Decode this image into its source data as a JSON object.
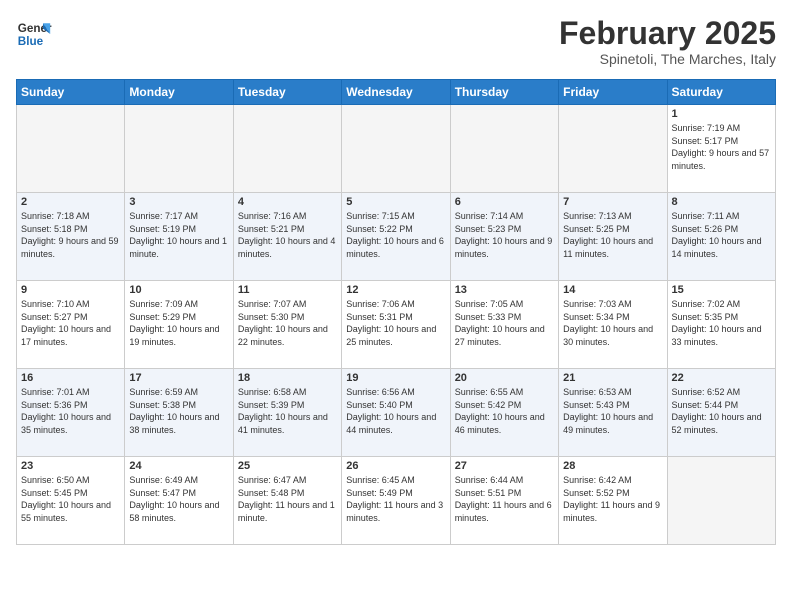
{
  "header": {
    "logo_general": "General",
    "logo_blue": "Blue",
    "month_title": "February 2025",
    "subtitle": "Spinetoli, The Marches, Italy"
  },
  "days_of_week": [
    "Sunday",
    "Monday",
    "Tuesday",
    "Wednesday",
    "Thursday",
    "Friday",
    "Saturday"
  ],
  "weeks": [
    {
      "alt": false,
      "days": [
        {
          "num": "",
          "info": ""
        },
        {
          "num": "",
          "info": ""
        },
        {
          "num": "",
          "info": ""
        },
        {
          "num": "",
          "info": ""
        },
        {
          "num": "",
          "info": ""
        },
        {
          "num": "",
          "info": ""
        },
        {
          "num": "1",
          "info": "Sunrise: 7:19 AM\nSunset: 5:17 PM\nDaylight: 9 hours and 57 minutes."
        }
      ]
    },
    {
      "alt": true,
      "days": [
        {
          "num": "2",
          "info": "Sunrise: 7:18 AM\nSunset: 5:18 PM\nDaylight: 9 hours and 59 minutes."
        },
        {
          "num": "3",
          "info": "Sunrise: 7:17 AM\nSunset: 5:19 PM\nDaylight: 10 hours and 1 minute."
        },
        {
          "num": "4",
          "info": "Sunrise: 7:16 AM\nSunset: 5:21 PM\nDaylight: 10 hours and 4 minutes."
        },
        {
          "num": "5",
          "info": "Sunrise: 7:15 AM\nSunset: 5:22 PM\nDaylight: 10 hours and 6 minutes."
        },
        {
          "num": "6",
          "info": "Sunrise: 7:14 AM\nSunset: 5:23 PM\nDaylight: 10 hours and 9 minutes."
        },
        {
          "num": "7",
          "info": "Sunrise: 7:13 AM\nSunset: 5:25 PM\nDaylight: 10 hours and 11 minutes."
        },
        {
          "num": "8",
          "info": "Sunrise: 7:11 AM\nSunset: 5:26 PM\nDaylight: 10 hours and 14 minutes."
        }
      ]
    },
    {
      "alt": false,
      "days": [
        {
          "num": "9",
          "info": "Sunrise: 7:10 AM\nSunset: 5:27 PM\nDaylight: 10 hours and 17 minutes."
        },
        {
          "num": "10",
          "info": "Sunrise: 7:09 AM\nSunset: 5:29 PM\nDaylight: 10 hours and 19 minutes."
        },
        {
          "num": "11",
          "info": "Sunrise: 7:07 AM\nSunset: 5:30 PM\nDaylight: 10 hours and 22 minutes."
        },
        {
          "num": "12",
          "info": "Sunrise: 7:06 AM\nSunset: 5:31 PM\nDaylight: 10 hours and 25 minutes."
        },
        {
          "num": "13",
          "info": "Sunrise: 7:05 AM\nSunset: 5:33 PM\nDaylight: 10 hours and 27 minutes."
        },
        {
          "num": "14",
          "info": "Sunrise: 7:03 AM\nSunset: 5:34 PM\nDaylight: 10 hours and 30 minutes."
        },
        {
          "num": "15",
          "info": "Sunrise: 7:02 AM\nSunset: 5:35 PM\nDaylight: 10 hours and 33 minutes."
        }
      ]
    },
    {
      "alt": true,
      "days": [
        {
          "num": "16",
          "info": "Sunrise: 7:01 AM\nSunset: 5:36 PM\nDaylight: 10 hours and 35 minutes."
        },
        {
          "num": "17",
          "info": "Sunrise: 6:59 AM\nSunset: 5:38 PM\nDaylight: 10 hours and 38 minutes."
        },
        {
          "num": "18",
          "info": "Sunrise: 6:58 AM\nSunset: 5:39 PM\nDaylight: 10 hours and 41 minutes."
        },
        {
          "num": "19",
          "info": "Sunrise: 6:56 AM\nSunset: 5:40 PM\nDaylight: 10 hours and 44 minutes."
        },
        {
          "num": "20",
          "info": "Sunrise: 6:55 AM\nSunset: 5:42 PM\nDaylight: 10 hours and 46 minutes."
        },
        {
          "num": "21",
          "info": "Sunrise: 6:53 AM\nSunset: 5:43 PM\nDaylight: 10 hours and 49 minutes."
        },
        {
          "num": "22",
          "info": "Sunrise: 6:52 AM\nSunset: 5:44 PM\nDaylight: 10 hours and 52 minutes."
        }
      ]
    },
    {
      "alt": false,
      "days": [
        {
          "num": "23",
          "info": "Sunrise: 6:50 AM\nSunset: 5:45 PM\nDaylight: 10 hours and 55 minutes."
        },
        {
          "num": "24",
          "info": "Sunrise: 6:49 AM\nSunset: 5:47 PM\nDaylight: 10 hours and 58 minutes."
        },
        {
          "num": "25",
          "info": "Sunrise: 6:47 AM\nSunset: 5:48 PM\nDaylight: 11 hours and 1 minute."
        },
        {
          "num": "26",
          "info": "Sunrise: 6:45 AM\nSunset: 5:49 PM\nDaylight: 11 hours and 3 minutes."
        },
        {
          "num": "27",
          "info": "Sunrise: 6:44 AM\nSunset: 5:51 PM\nDaylight: 11 hours and 6 minutes."
        },
        {
          "num": "28",
          "info": "Sunrise: 6:42 AM\nSunset: 5:52 PM\nDaylight: 11 hours and 9 minutes."
        },
        {
          "num": "",
          "info": ""
        }
      ]
    }
  ]
}
